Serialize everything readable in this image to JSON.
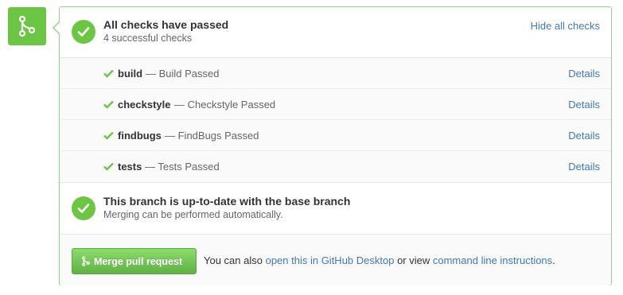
{
  "status": {
    "title": "All checks have passed",
    "subtitle": "4 successful checks",
    "hide_label": "Hide all checks"
  },
  "checks": [
    {
      "name": "build",
      "description": "— Build Passed",
      "details_label": "Details"
    },
    {
      "name": "checkstyle",
      "description": "— Checkstyle Passed",
      "details_label": "Details"
    },
    {
      "name": "findbugs",
      "description": "— FindBugs Passed",
      "details_label": "Details"
    },
    {
      "name": "tests",
      "description": "— Tests Passed",
      "details_label": "Details"
    }
  ],
  "branch": {
    "title": "This branch is up-to-date with the base branch",
    "subtitle": "Merging can be performed automatically."
  },
  "merge": {
    "button_label": "Merge pull request",
    "text_prefix": "You can also ",
    "desktop_link": "open this in GitHub Desktop",
    "text_middle": " or view ",
    "cli_link": "command line instructions",
    "text_suffix": "."
  },
  "colors": {
    "success": "#6cc644",
    "link": "#4078c0",
    "border": "#8fd67a"
  },
  "icons": {
    "merge": "git-merge-icon",
    "check": "check-icon"
  }
}
